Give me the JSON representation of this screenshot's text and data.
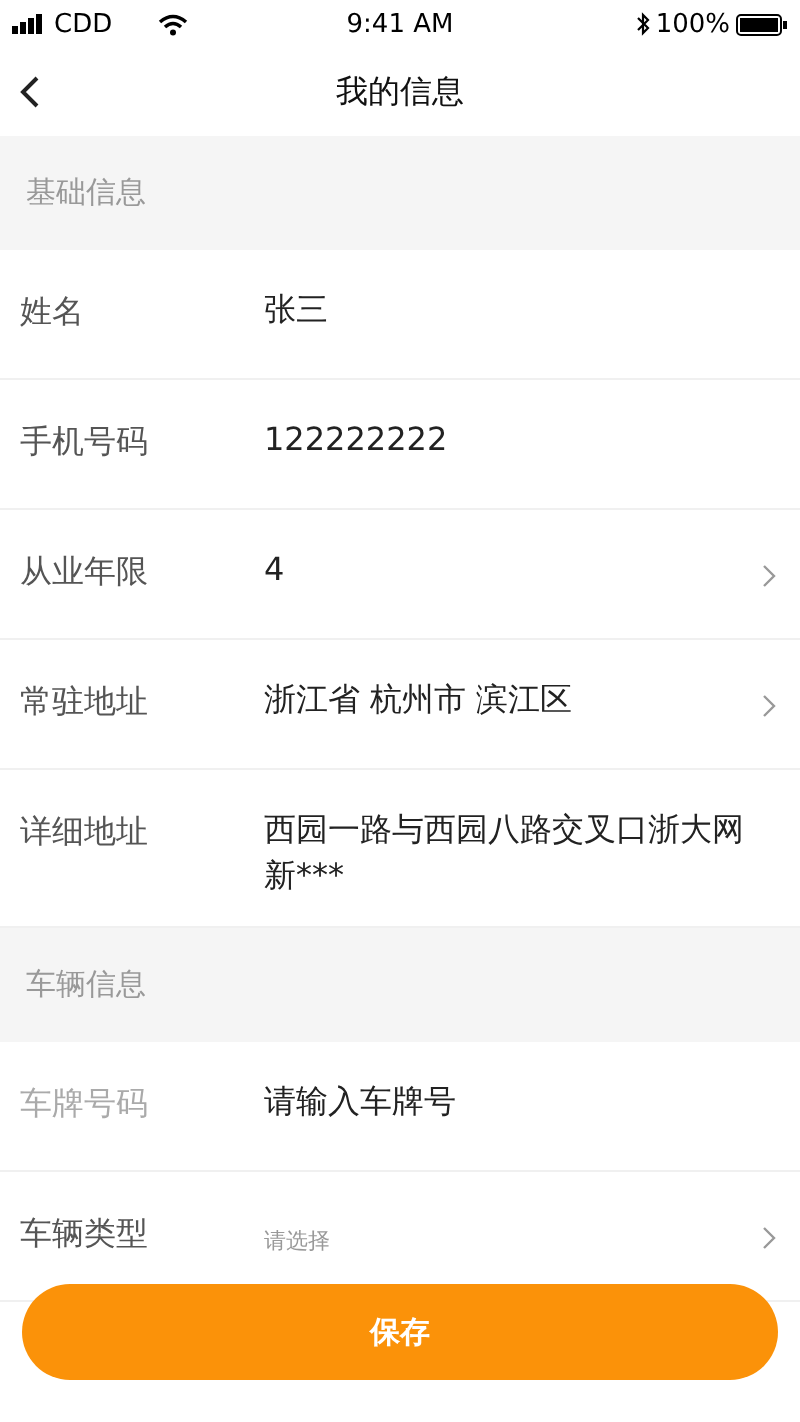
{
  "status_bar": {
    "carrier": "CDD",
    "time": "9:41 AM",
    "battery": "100%"
  },
  "nav": {
    "title": "我的信息"
  },
  "sections": [
    {
      "title": "基础信息",
      "rows": [
        {
          "label": "姓名",
          "value": "张三",
          "kind": "text",
          "disabled": false
        },
        {
          "label": "手机号码",
          "value": "122222222",
          "kind": "text",
          "disabled": false
        },
        {
          "label": "从业年限",
          "value": "4",
          "kind": "select",
          "disabled": false
        },
        {
          "label": "常驻地址",
          "value": "浙江省 杭州市 滨江区",
          "kind": "select",
          "disabled": false
        },
        {
          "label": "详细地址",
          "value": "西园一路与西园八路交叉口浙大网新***",
          "kind": "text",
          "disabled": false
        }
      ]
    },
    {
      "title": "车辆信息",
      "rows": [
        {
          "label": "车牌号码",
          "value": "请输入车牌号",
          "kind": "text",
          "disabled": true
        },
        {
          "label": "车辆类型",
          "placeholder": "请选择",
          "kind": "select",
          "disabled": false
        }
      ]
    }
  ],
  "save_button": {
    "label": "保存"
  }
}
